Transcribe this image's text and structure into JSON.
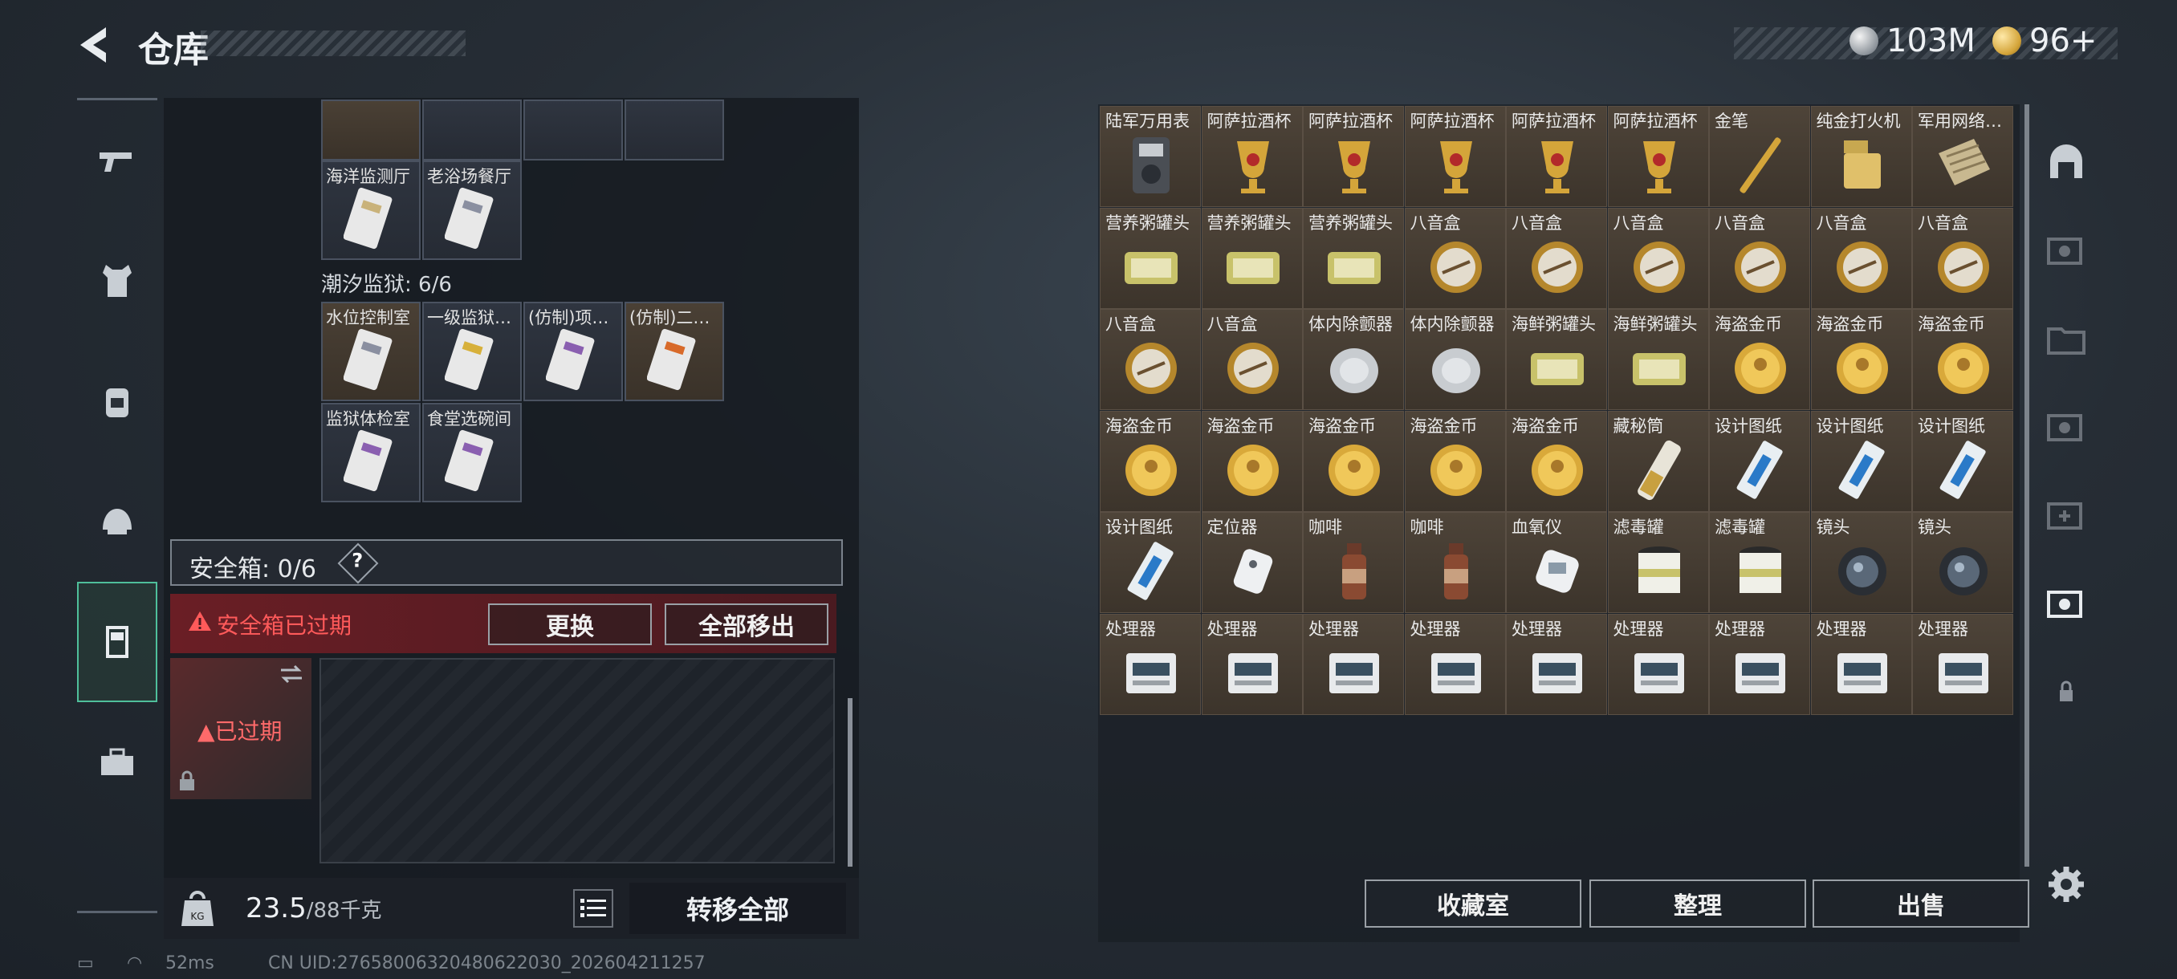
{
  "header": {
    "title": "仓库"
  },
  "currency": {
    "silver": "103M",
    "gold": "96+"
  },
  "colors": {
    "accent_green": "#4fbf9b",
    "warn_red": "#ff5a5a",
    "tile_brown": "#4e4439"
  },
  "left_nav": [
    "gun-icon",
    "armor-icon",
    "backpack-icon",
    "helmet-icon",
    "safe-box-icon",
    "toolbox-icon"
  ],
  "stash": {
    "top_row_count": 4,
    "group1": [
      "海洋监测厅",
      "老浴场餐厅"
    ],
    "prison_label": "潮汐监狱: 6/6",
    "group2_row1": [
      "水位控制室",
      "一级监狱…",
      "(仿制)项…",
      "(仿制)二…"
    ],
    "group2_row2": [
      "监狱体检室",
      "食堂选碗间"
    ]
  },
  "safe_box": {
    "label": "安全箱: 0/6",
    "help": "?",
    "expired_banner": "安全箱已过期",
    "replace_button": "更换",
    "move_all_button": "全部移出",
    "expired_tag": "已过期"
  },
  "bottom": {
    "weight": "23.5",
    "weight_max": "/88千克",
    "transfer_all": "转移全部"
  },
  "inventory": [
    [
      "陆军万用表",
      "阿萨拉酒杯",
      "阿萨拉酒杯",
      "阿萨拉酒杯",
      "阿萨拉酒杯",
      "阿萨拉酒杯",
      "金笔",
      "纯金打火机",
      "军用网络…"
    ],
    [
      "营养粥罐头",
      "营养粥罐头",
      "营养粥罐头",
      "八音盒",
      "八音盒",
      "八音盒",
      "八音盒",
      "八音盒",
      "八音盒"
    ],
    [
      "八音盒",
      "八音盒",
      "体内除颤器",
      "体内除颤器",
      "海鲜粥罐头",
      "海鲜粥罐头",
      "海盗金币",
      "海盗金币",
      "海盗金币"
    ],
    [
      "海盗金币",
      "海盗金币",
      "海盗金币",
      "海盗金币",
      "海盗金币",
      "藏秘筒",
      "设计图纸",
      "设计图纸",
      "设计图纸"
    ],
    [
      "设计图纸",
      "定位器",
      "咖啡",
      "咖啡",
      "血氧仪",
      "滤毒罐",
      "滤毒罐",
      "镜头",
      "镜头"
    ],
    [
      "处理器",
      "处理器",
      "处理器",
      "处理器",
      "处理器",
      "处理器",
      "处理器",
      "处理器",
      "处理器"
    ]
  ],
  "actions": {
    "collection": "收藏室",
    "sort": "整理",
    "sell": "出售"
  },
  "status_bar": {
    "ping": "52ms",
    "uid": "CN UID:27658006320480622030_202604211257"
  }
}
